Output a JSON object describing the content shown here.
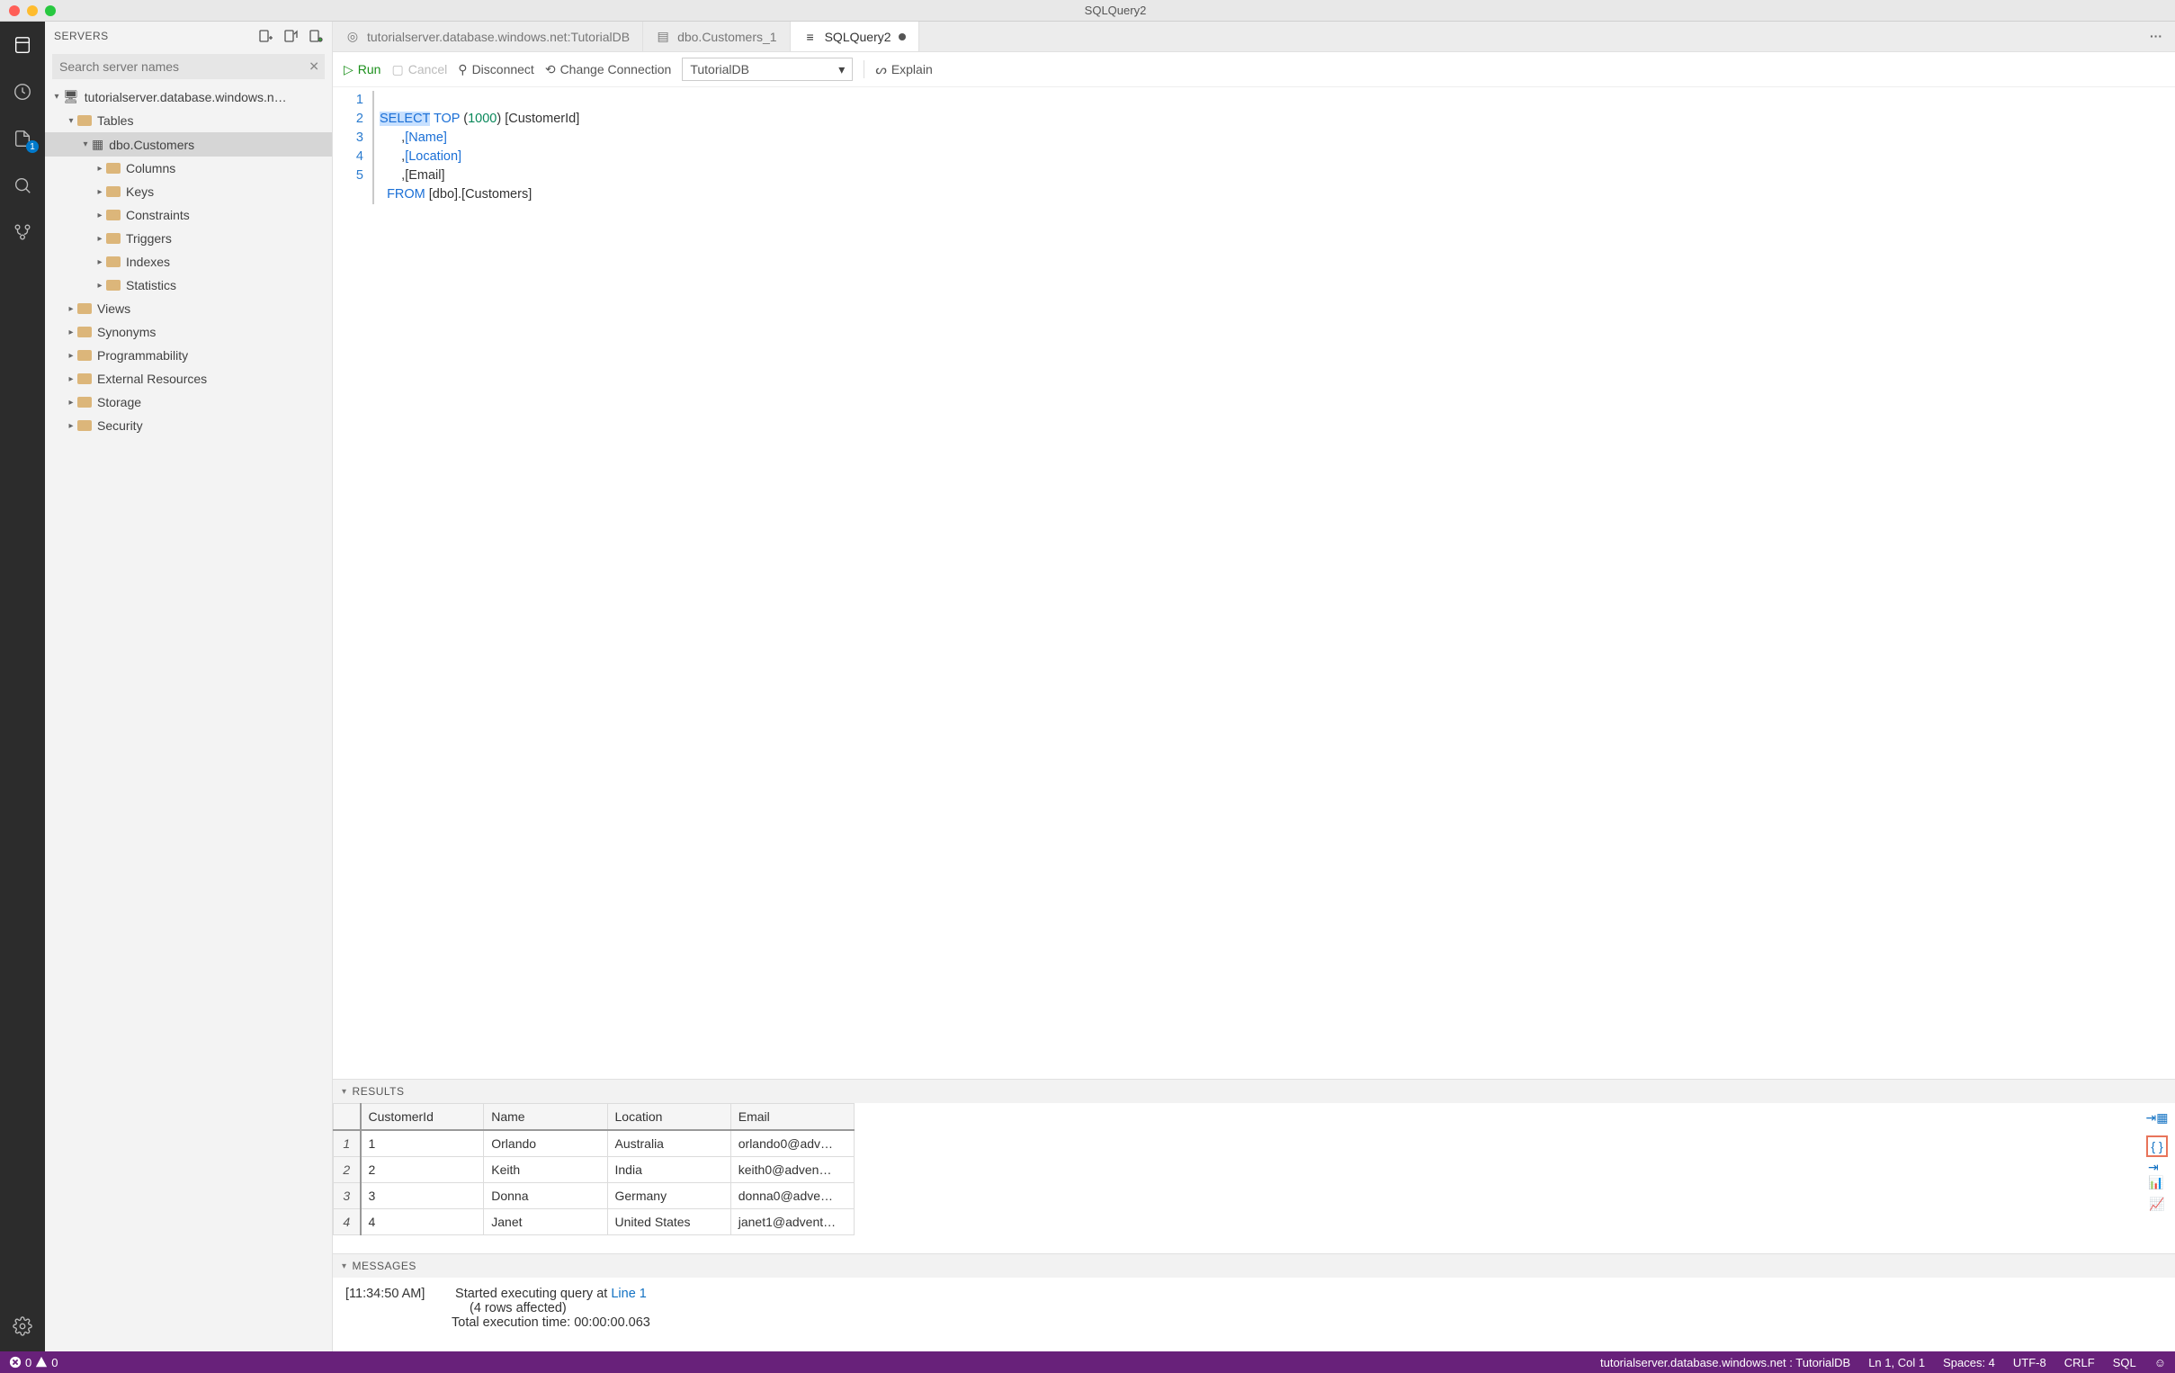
{
  "window": {
    "title": "SQLQuery2"
  },
  "activity": {
    "file_badge": "1"
  },
  "sidebar": {
    "title": "SERVERS",
    "search_placeholder": "Search server names",
    "server": "tutorialserver.database.windows.n…",
    "groups": {
      "tables": "Tables",
      "table_name": "dbo.Customers",
      "folders": [
        "Columns",
        "Keys",
        "Constraints",
        "Triggers",
        "Indexes",
        "Statistics"
      ],
      "others": [
        "Views",
        "Synonyms",
        "Programmability",
        "External Resources",
        "Storage",
        "Security"
      ]
    }
  },
  "tabs": [
    {
      "label": "tutorialserver.database.windows.net:TutorialDB",
      "icon": "dashboard",
      "active": false
    },
    {
      "label": "dbo.Customers_1",
      "icon": "table",
      "active": false
    },
    {
      "label": "SQLQuery2",
      "icon": "db",
      "active": true,
      "dirty": true
    }
  ],
  "toolbar": {
    "run": "Run",
    "cancel": "Cancel",
    "disconnect": "Disconnect",
    "change": "Change Connection",
    "db": "TutorialDB",
    "explain": "Explain"
  },
  "code": {
    "lines": [
      "1",
      "2",
      "3",
      "4",
      "5"
    ],
    "l1a": "SELECT",
    "l1b": "TOP",
    "l1c": "1000",
    "l1d": "[CustomerId]",
    "l2": "[Name]",
    "l3": "[Location]",
    "l4": "[Email]",
    "l5a": "FROM",
    "l5b": "[dbo].[Customers]"
  },
  "results": {
    "title": "RESULTS",
    "columns": [
      "CustomerId",
      "Name",
      "Location",
      "Email"
    ],
    "rows": [
      {
        "n": "1",
        "CustomerId": "1",
        "Name": "Orlando",
        "Location": "Australia",
        "Email": "orlando0@adv…"
      },
      {
        "n": "2",
        "CustomerId": "2",
        "Name": "Keith",
        "Location": "India",
        "Email": "keith0@adven…"
      },
      {
        "n": "3",
        "CustomerId": "3",
        "Name": "Donna",
        "Location": "Germany",
        "Email": "donna0@adve…"
      },
      {
        "n": "4",
        "CustomerId": "4",
        "Name": "Janet",
        "Location": "United States",
        "Email": "janet1@advent…"
      }
    ]
  },
  "messages": {
    "title": "MESSAGES",
    "ts": "[11:34:50 AM]",
    "l1a": "Started executing query at ",
    "l1b": "Line 1",
    "l2": "(4 rows affected)",
    "l3": "Total execution time: 00:00:00.063"
  },
  "status": {
    "errors": "0",
    "warnings": "0",
    "conn": "tutorialserver.database.windows.net : TutorialDB",
    "pos": "Ln 1, Col 1",
    "spaces": "Spaces: 4",
    "enc": "UTF-8",
    "eol": "CRLF",
    "lang": "SQL"
  }
}
